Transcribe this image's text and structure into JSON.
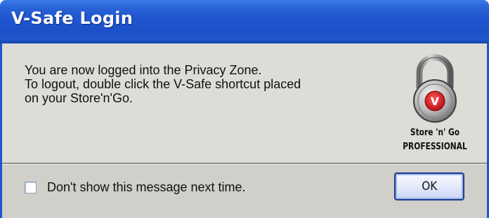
{
  "window": {
    "title": "V-Safe Login"
  },
  "message": {
    "lines": [
      "You are now logged into the Privacy Zone.",
      "To logout, double click the V-Safe shortcut placed",
      "on your Store'n'Go."
    ]
  },
  "logo": {
    "icon": "padlock-icon",
    "badge_letter": "V",
    "brand_line1": "Store 'n' Go",
    "brand_line2": "PROFESSIONAL"
  },
  "footer": {
    "checkbox_label": "Don't show this message next time.",
    "checkbox_checked": false,
    "ok_label": "OK"
  },
  "colors": {
    "titlebar": "#1f56d0",
    "content_bg": "#dddcd6",
    "footer_bg": "#d0cfc9",
    "badge_red": "#d7191c"
  }
}
